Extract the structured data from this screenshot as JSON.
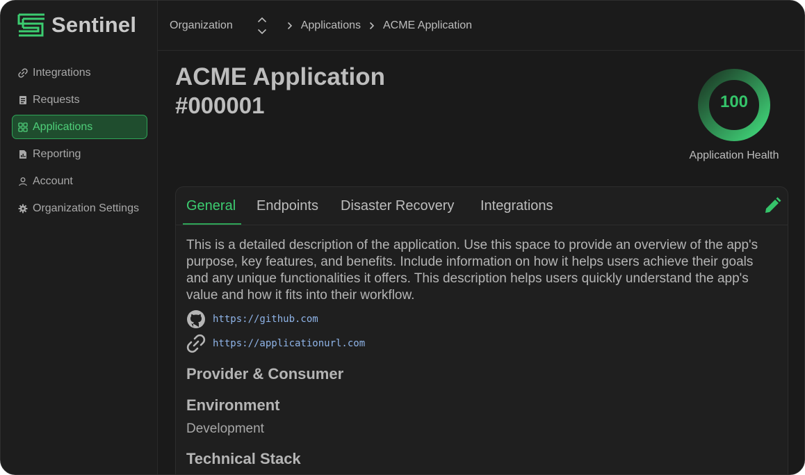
{
  "app": {
    "name": "Sentinel"
  },
  "sidebar": {
    "items": [
      {
        "label": "Integrations",
        "icon": "link-icon"
      },
      {
        "label": "Requests",
        "icon": "clipboard-icon"
      },
      {
        "label": "Applications",
        "icon": "grid-icon",
        "active": true
      },
      {
        "label": "Reporting",
        "icon": "report-icon"
      },
      {
        "label": "Account",
        "icon": "user-icon"
      },
      {
        "label": "Organization Settings",
        "icon": "gear-icon"
      }
    ]
  },
  "breadcrumb": {
    "organization": "Organization",
    "applications": "Applications",
    "current": "ACME Application"
  },
  "page": {
    "title": "ACME Application",
    "id": "#000001"
  },
  "health": {
    "value": "100",
    "label": "Application Health"
  },
  "tabs": [
    {
      "label": "General",
      "active": true
    },
    {
      "label": "Endpoints"
    },
    {
      "label": "Disaster Recovery"
    },
    {
      "label": "Integrations"
    }
  ],
  "general": {
    "description": "This is a detailed description of the application. Use this space to provide an overview of the app's purpose, key features, and benefits. Include information on how it helps users achieve their goals and any unique functionalities it offers. This description helps users quickly understand the app's value and how it fits into their workflow.",
    "github_url": "https://github.com",
    "app_url": "https://applicationurl.com",
    "provider_heading": "Provider & Consumer",
    "environment_heading": "Environment",
    "environment_value": "Development",
    "stack_heading": "Technical Stack"
  },
  "colors": {
    "accent": "#3ccc70",
    "active_bg": "#1f4d2e",
    "link": "#8fb4e8",
    "background": "#1a1a1a"
  }
}
